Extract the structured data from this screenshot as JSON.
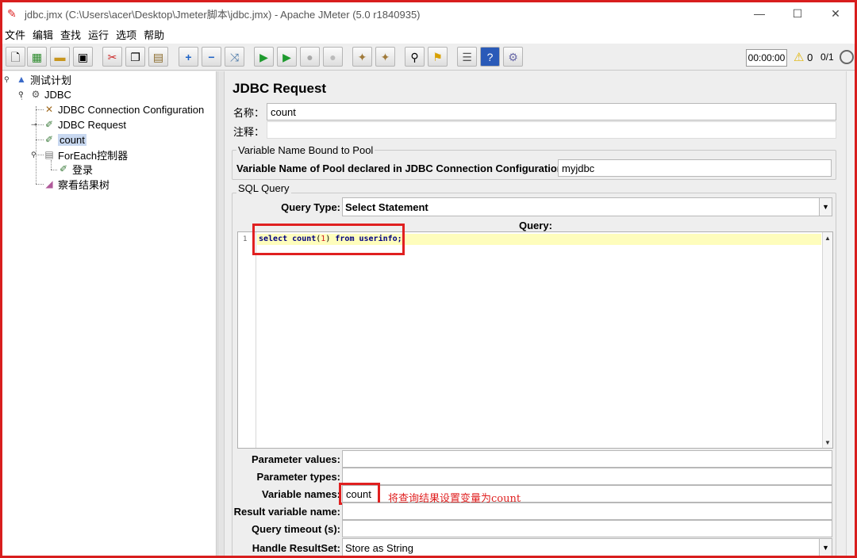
{
  "window": {
    "title": "jdbc.jmx (C:\\Users\\acer\\Desktop\\Jmeter脚本\\jdbc.jmx) - Apache JMeter (5.0 r1840935)",
    "minimize": "—",
    "maximize": "☐",
    "close": "✕"
  },
  "menu": [
    "文件",
    "编辑",
    "查找",
    "运行",
    "选项",
    "帮助"
  ],
  "toolbar": {
    "timer": "00:00:00",
    "warnings": "0",
    "threads": "0/1"
  },
  "tree": {
    "items": [
      {
        "label": "测试计划",
        "icon": "test-plan-icon"
      },
      {
        "label": "JDBC",
        "icon": "thread-group-icon"
      },
      {
        "label": "JDBC Connection Configuration",
        "icon": "config-element-icon"
      },
      {
        "label": "JDBC Request",
        "icon": "sampler-icon"
      },
      {
        "label": "count",
        "icon": "sampler-icon",
        "selected": true
      },
      {
        "label": "ForEach控制器",
        "icon": "controller-icon"
      },
      {
        "label": "登录",
        "icon": "sampler-icon"
      },
      {
        "label": "察看结果树",
        "icon": "listener-icon"
      }
    ]
  },
  "panel": {
    "title": "JDBC Request",
    "name_label": "名称：",
    "name_value": "count",
    "comment_label": "注释：",
    "comment_value": "",
    "pool_group_title": "Variable Name Bound to Pool",
    "pool_label": "Variable Name of Pool declared in JDBC Connection Configuration:",
    "pool_value": "myjdbc",
    "sql_group_title": "SQL Query",
    "query_type_label": "Query Type:",
    "query_type_value": "Select Statement",
    "query_label": "Query:",
    "query_line_number": "1",
    "query_code": {
      "kw1": "select ",
      "fn": "count",
      "paren_open": "(",
      "num": "1",
      "paren_close": ")",
      "kw2": " from ",
      "table": "userinfo;"
    },
    "param_values_label": "Parameter values:",
    "param_values_value": "",
    "param_types_label": "Parameter types:",
    "param_types_value": "",
    "var_names_label": "Variable names:",
    "var_names_value": "count",
    "result_var_label": "Result variable name:",
    "result_var_value": "",
    "timeout_label": "Query timeout (s):",
    "timeout_value": "",
    "resultset_label": "Handle ResultSet:",
    "resultset_value": "Store as String"
  },
  "annotation": {
    "text": "将查询结果设置变量为count",
    "color": "#e02020"
  }
}
